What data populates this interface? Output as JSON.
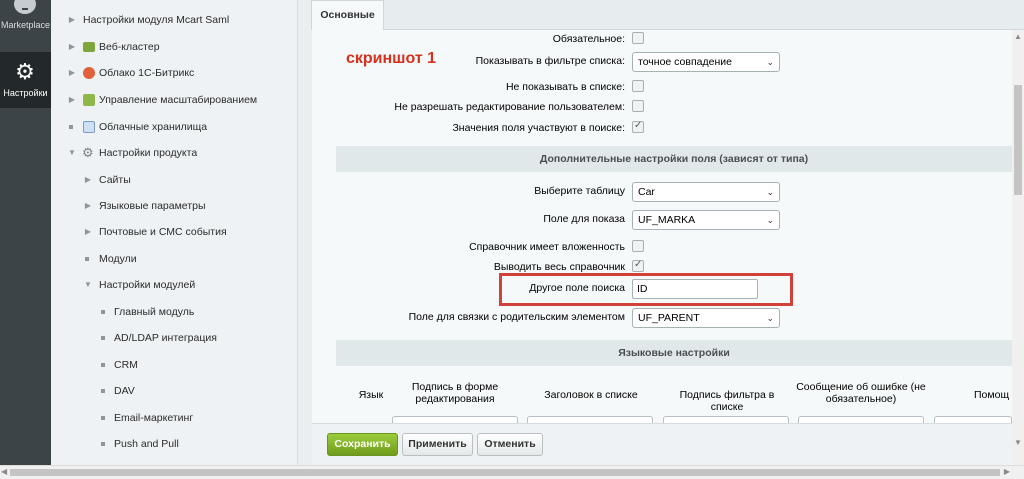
{
  "leftbar": {
    "marketplace_label": "Marketplace",
    "settings_label": "Настройки"
  },
  "tree": [
    {
      "label": "Настройки модуля Mcart Saml",
      "mark": "▶",
      "icon": "none"
    },
    {
      "label": "Веб-кластер",
      "mark": "▶",
      "icon": "cluster-icon"
    },
    {
      "label": "Облако 1С-Битрикс",
      "mark": "▶",
      "icon": "cloud-icon"
    },
    {
      "label": "Управление масштабированием",
      "mark": "▶",
      "icon": "scale-icon"
    },
    {
      "label": "Облачные хранилища",
      "mark": "■",
      "icon": "storage-icon"
    },
    {
      "label": "Настройки продукта",
      "mark": "▼",
      "icon": "gear-icon"
    },
    {
      "label": "Сайты",
      "mark": "▶"
    },
    {
      "label": "Языковые параметры",
      "mark": "▶"
    },
    {
      "label": "Почтовые и СМС события",
      "mark": "▶"
    },
    {
      "label": "Модули",
      "mark": "■"
    },
    {
      "label": "Настройки модулей",
      "mark": "▼"
    },
    {
      "label": "Главный модуль",
      "mark": "■"
    },
    {
      "label": "AD/LDAP интеграция",
      "mark": "■"
    },
    {
      "label": "CRM",
      "mark": "■"
    },
    {
      "label": "DAV",
      "mark": "■"
    },
    {
      "label": "Email-маркетинг",
      "mark": "■"
    },
    {
      "label": "Push and Pull",
      "mark": "■"
    }
  ],
  "tabs": {
    "main": "Основные"
  },
  "annotation": "скриншот 1",
  "form": {
    "required_label": "Обязательное:",
    "filter_label": "Показывать в фильтре списка:",
    "filter_value": "точное совпадение",
    "hide_label": "Не показывать в списке:",
    "no_edit_label": "Не разрешать редактирование пользователем:",
    "search_label": "Значения поля участвуют в поиске:",
    "section_extra": "Дополнительные настройки поля (зависят от типа)",
    "table_label": "Выберите таблицу",
    "table_value": "Car",
    "display_label": "Поле для показа",
    "display_value": "UF_MARKA",
    "nested_label": "Справочник имеет вложенность",
    "whole_label": "Выводить весь справочник",
    "other_search_label": "Другое поле поиска",
    "other_search_value": "ID",
    "parent_label": "Поле для связки с родительским элементом",
    "parent_value": "UF_PARENT",
    "section_lang": "Языковые настройки",
    "columns": {
      "lang": "Язык",
      "edit_form": "Подпись в форме редактирования",
      "list_header": "Заголовок в списке",
      "filter_caption": "Подпись фильтра в списке",
      "error_msg": "Сообщение об ошибке (не обязательное)",
      "help": "Помощ"
    }
  },
  "checks": {
    "required": false,
    "hide": false,
    "no_edit": false,
    "search": true,
    "nested": false,
    "whole": true
  },
  "buttons": {
    "save": "Сохранить",
    "apply": "Применить",
    "cancel": "Отменить"
  }
}
